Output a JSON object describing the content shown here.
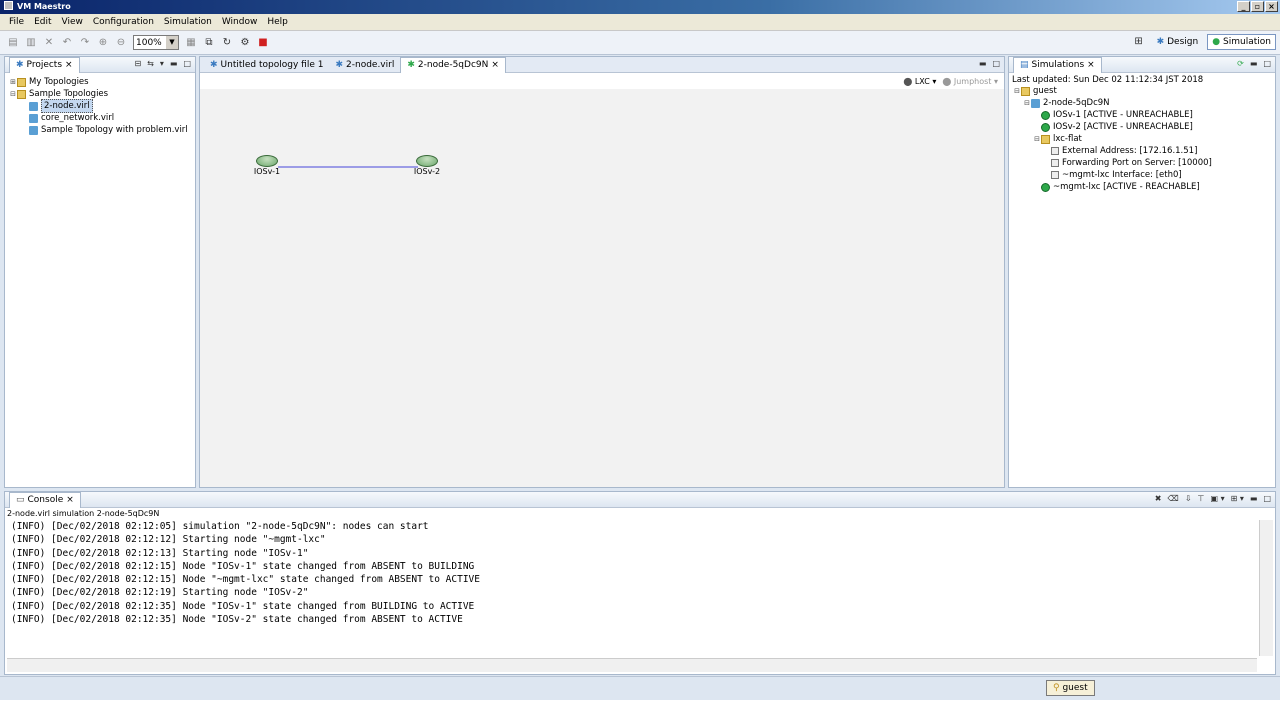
{
  "window": {
    "title": "VM Maestro"
  },
  "menu": [
    "File",
    "Edit",
    "View",
    "Configuration",
    "Simulation",
    "Window",
    "Help"
  ],
  "toolbar": {
    "zoom": "100%"
  },
  "perspectives": {
    "design": "Design",
    "simulation": "Simulation"
  },
  "projects": {
    "tab": "Projects",
    "items": [
      {
        "label": "My Topologies",
        "level": 0,
        "type": "folder"
      },
      {
        "label": "Sample Topologies",
        "level": 0,
        "type": "folder"
      },
      {
        "label": "2-node.virl",
        "level": 1,
        "type": "topo",
        "selected": true
      },
      {
        "label": "core_network.virl",
        "level": 1,
        "type": "topo"
      },
      {
        "label": "Sample Topology with problem.virl",
        "level": 1,
        "type": "topo"
      }
    ]
  },
  "editor": {
    "tabs": [
      "Untitled topology file 1",
      "2-node.virl",
      "2-node-5qDc9N"
    ],
    "lxc_label": "LXC",
    "jumphost_label": "Jumphost",
    "nodes": [
      "IOSv-1",
      "IOSv-2"
    ]
  },
  "simulations": {
    "tab": "Simulations",
    "last_updated": "Last updated: Sun Dec 02 11:12:34 JST 2018",
    "rows": [
      {
        "label": "guest",
        "level": 0,
        "icon": "folder"
      },
      {
        "label": "2-node-5qDc9N",
        "level": 1,
        "icon": "topo"
      },
      {
        "label": "IOSv-1 [ACTIVE - UNREACHABLE]",
        "level": 2,
        "icon": "green"
      },
      {
        "label": "IOSv-2 [ACTIVE - UNREACHABLE]",
        "level": 2,
        "icon": "green"
      },
      {
        "label": "lxc-flat",
        "level": 2,
        "icon": "folder"
      },
      {
        "label": "External Address: [172.16.1.51]",
        "level": 3,
        "icon": "prop"
      },
      {
        "label": "Forwarding Port on Server: [10000]",
        "level": 3,
        "icon": "prop"
      },
      {
        "label": "~mgmt-lxc Interface: [eth0]",
        "level": 3,
        "icon": "prop"
      },
      {
        "label": "~mgmt-lxc [ACTIVE - REACHABLE]",
        "level": 2,
        "icon": "green"
      }
    ]
  },
  "console": {
    "tab": "Console",
    "subtitle": "2-node.virl simulation 2-node-5qDc9N",
    "lines": [
      "(INFO) [Dec/02/2018 02:12:05] simulation \"2-node-5qDc9N\": nodes can start",
      "(INFO) [Dec/02/2018 02:12:12] Starting node \"~mgmt-lxc\"",
      "(INFO) [Dec/02/2018 02:12:13] Starting node \"IOSv-1\"",
      "(INFO) [Dec/02/2018 02:12:15] Node \"IOSv-1\" state changed from ABSENT to BUILDING",
      "(INFO) [Dec/02/2018 02:12:15] Node \"~mgmt-lxc\" state changed from ABSENT to ACTIVE",
      "(INFO) [Dec/02/2018 02:12:19] Starting node \"IOSv-2\"",
      "(INFO) [Dec/02/2018 02:12:35] Node \"IOSv-1\" state changed from BUILDING to ACTIVE",
      "(INFO) [Dec/02/2018 02:12:35] Node \"IOSv-2\" state changed from ABSENT to ACTIVE"
    ]
  },
  "status": {
    "user": "guest"
  }
}
